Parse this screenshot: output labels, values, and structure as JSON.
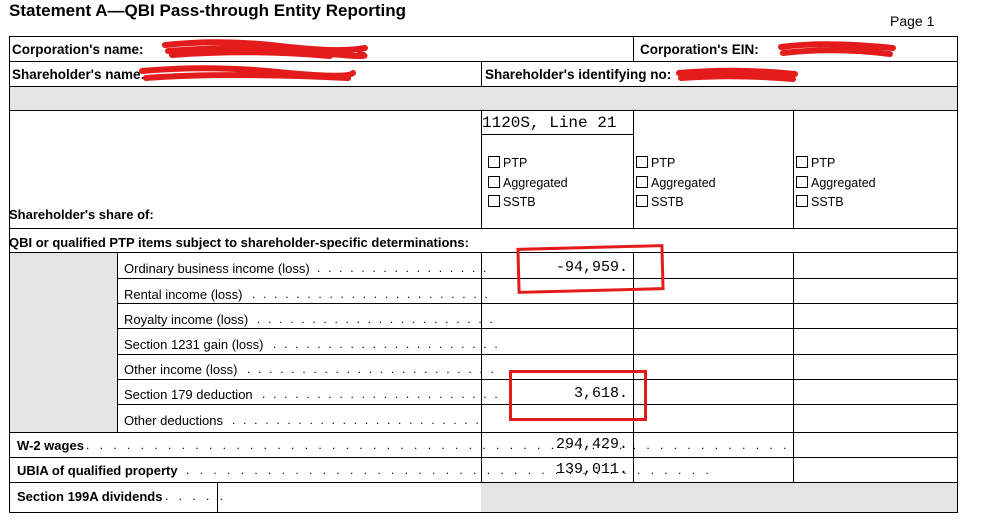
{
  "header": {
    "title": "Statement A—QBI Pass-through Entity Reporting",
    "page": "Page 1"
  },
  "top_rows": {
    "corp_name_label": "Corporation's name:",
    "corp_ein_label": "Corporation's EIN:",
    "shareholder_name_label": "Shareholder's name:",
    "shareholder_id_label": "Shareholder's identifying no:"
  },
  "columns": {
    "col1_header": "1120S, Line 21",
    "checkbox_labels": [
      "PTP",
      "Aggregated",
      "SSTB"
    ]
  },
  "sections": {
    "share_of": "Shareholder's share of:",
    "qbi_heading": "QBI or qualified PTP items subject to shareholder-specific determinations:"
  },
  "items": [
    {
      "label": "Ordinary business income (loss)",
      "value": "-94,959."
    },
    {
      "label": "Rental income (loss)",
      "value": ""
    },
    {
      "label": "Royalty income (loss)",
      "value": ""
    },
    {
      "label": "Section 1231 gain (loss)",
      "value": ""
    },
    {
      "label": "Other income (loss)",
      "value": ""
    },
    {
      "label": "Section 179 deduction",
      "value": "3,618."
    },
    {
      "label": "Other deductions",
      "value": ""
    }
  ],
  "totals": [
    {
      "label": "W-2 wages",
      "value": "294,429."
    },
    {
      "label": "UBIA of qualified property",
      "value": "139,011."
    },
    {
      "label": "Section 199A dividends",
      "value": ""
    }
  ],
  "annotations": {
    "redaction_color": "#e31b1b",
    "highlight_color": "#e31b1b"
  }
}
